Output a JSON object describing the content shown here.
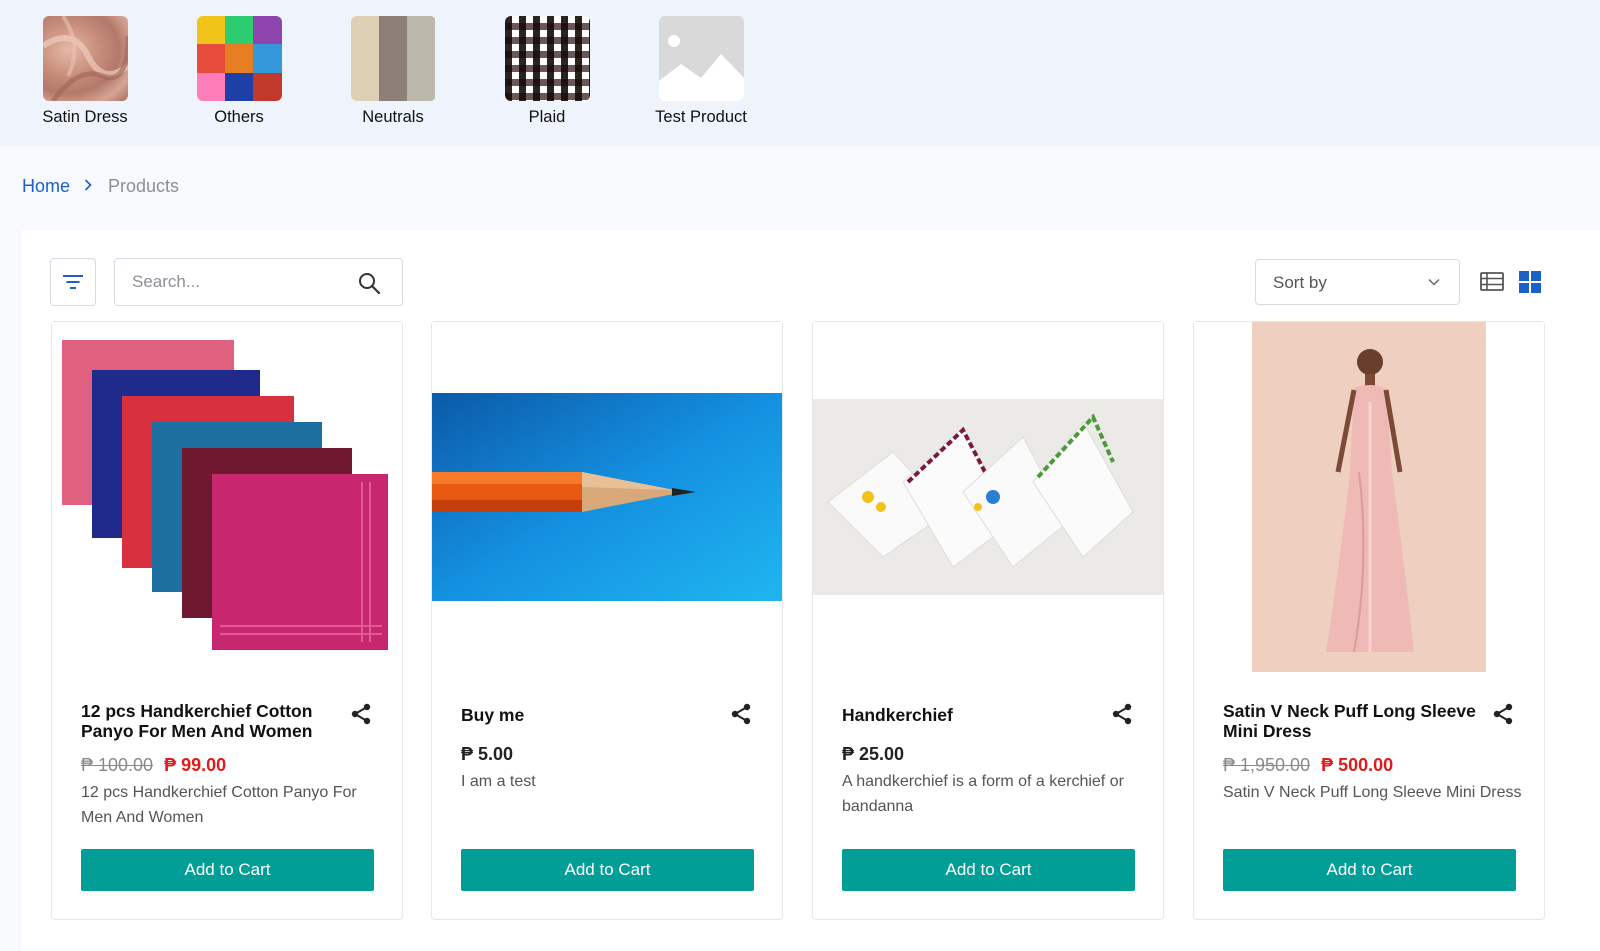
{
  "categories": [
    {
      "label": "Satin Dress",
      "thumb_icon": "satin-fabric-image"
    },
    {
      "label": "Others",
      "thumb_icon": "colorful-fabrics-image"
    },
    {
      "label": "Neutrals",
      "thumb_icon": "neutral-stripes-image"
    },
    {
      "label": "Plaid",
      "thumb_icon": "plaid-pattern-image"
    },
    {
      "label": "Test Product",
      "thumb_icon": "image-placeholder-icon"
    }
  ],
  "breadcrumb": {
    "home": "Home",
    "current": "Products"
  },
  "toolbar": {
    "search_placeholder": "Search...",
    "sort_label": "Sort by",
    "active_view": "grid",
    "accent_color": "#1b5fc9"
  },
  "products": [
    {
      "title": "12 pcs Handkerchief Cotton Panyo For Men And Women",
      "old_price": "₱ 100.00",
      "price": "₱ 99.00",
      "description": "12 pcs Handkerchief Cotton Panyo For Men And Women",
      "button": "Add to Cart",
      "image_icon": "colored-handkerchiefs-image"
    },
    {
      "title": "Buy me",
      "price": "₱ 5.00",
      "description": "I am a test",
      "button": "Add to Cart",
      "image_icon": "pencil-image"
    },
    {
      "title": "Handkerchief",
      "price": "₱ 25.00",
      "description": "A handkerchief is a form of a kerchief or bandanna",
      "button": "Add to Cart",
      "image_icon": "embroidered-handkerchiefs-image"
    },
    {
      "title": "Satin V Neck Puff Long Sleeve Mini Dress",
      "old_price": "₱ 1,950.00",
      "price": "₱ 500.00",
      "description": "Satin V Neck Puff Long Sleeve Mini Dress",
      "button": "Add to Cart",
      "image_icon": "pink-satin-dress-image"
    }
  ],
  "colors": {
    "button": "#009e96",
    "sale_price": "#e01b1b",
    "link": "#1b5fc9"
  }
}
